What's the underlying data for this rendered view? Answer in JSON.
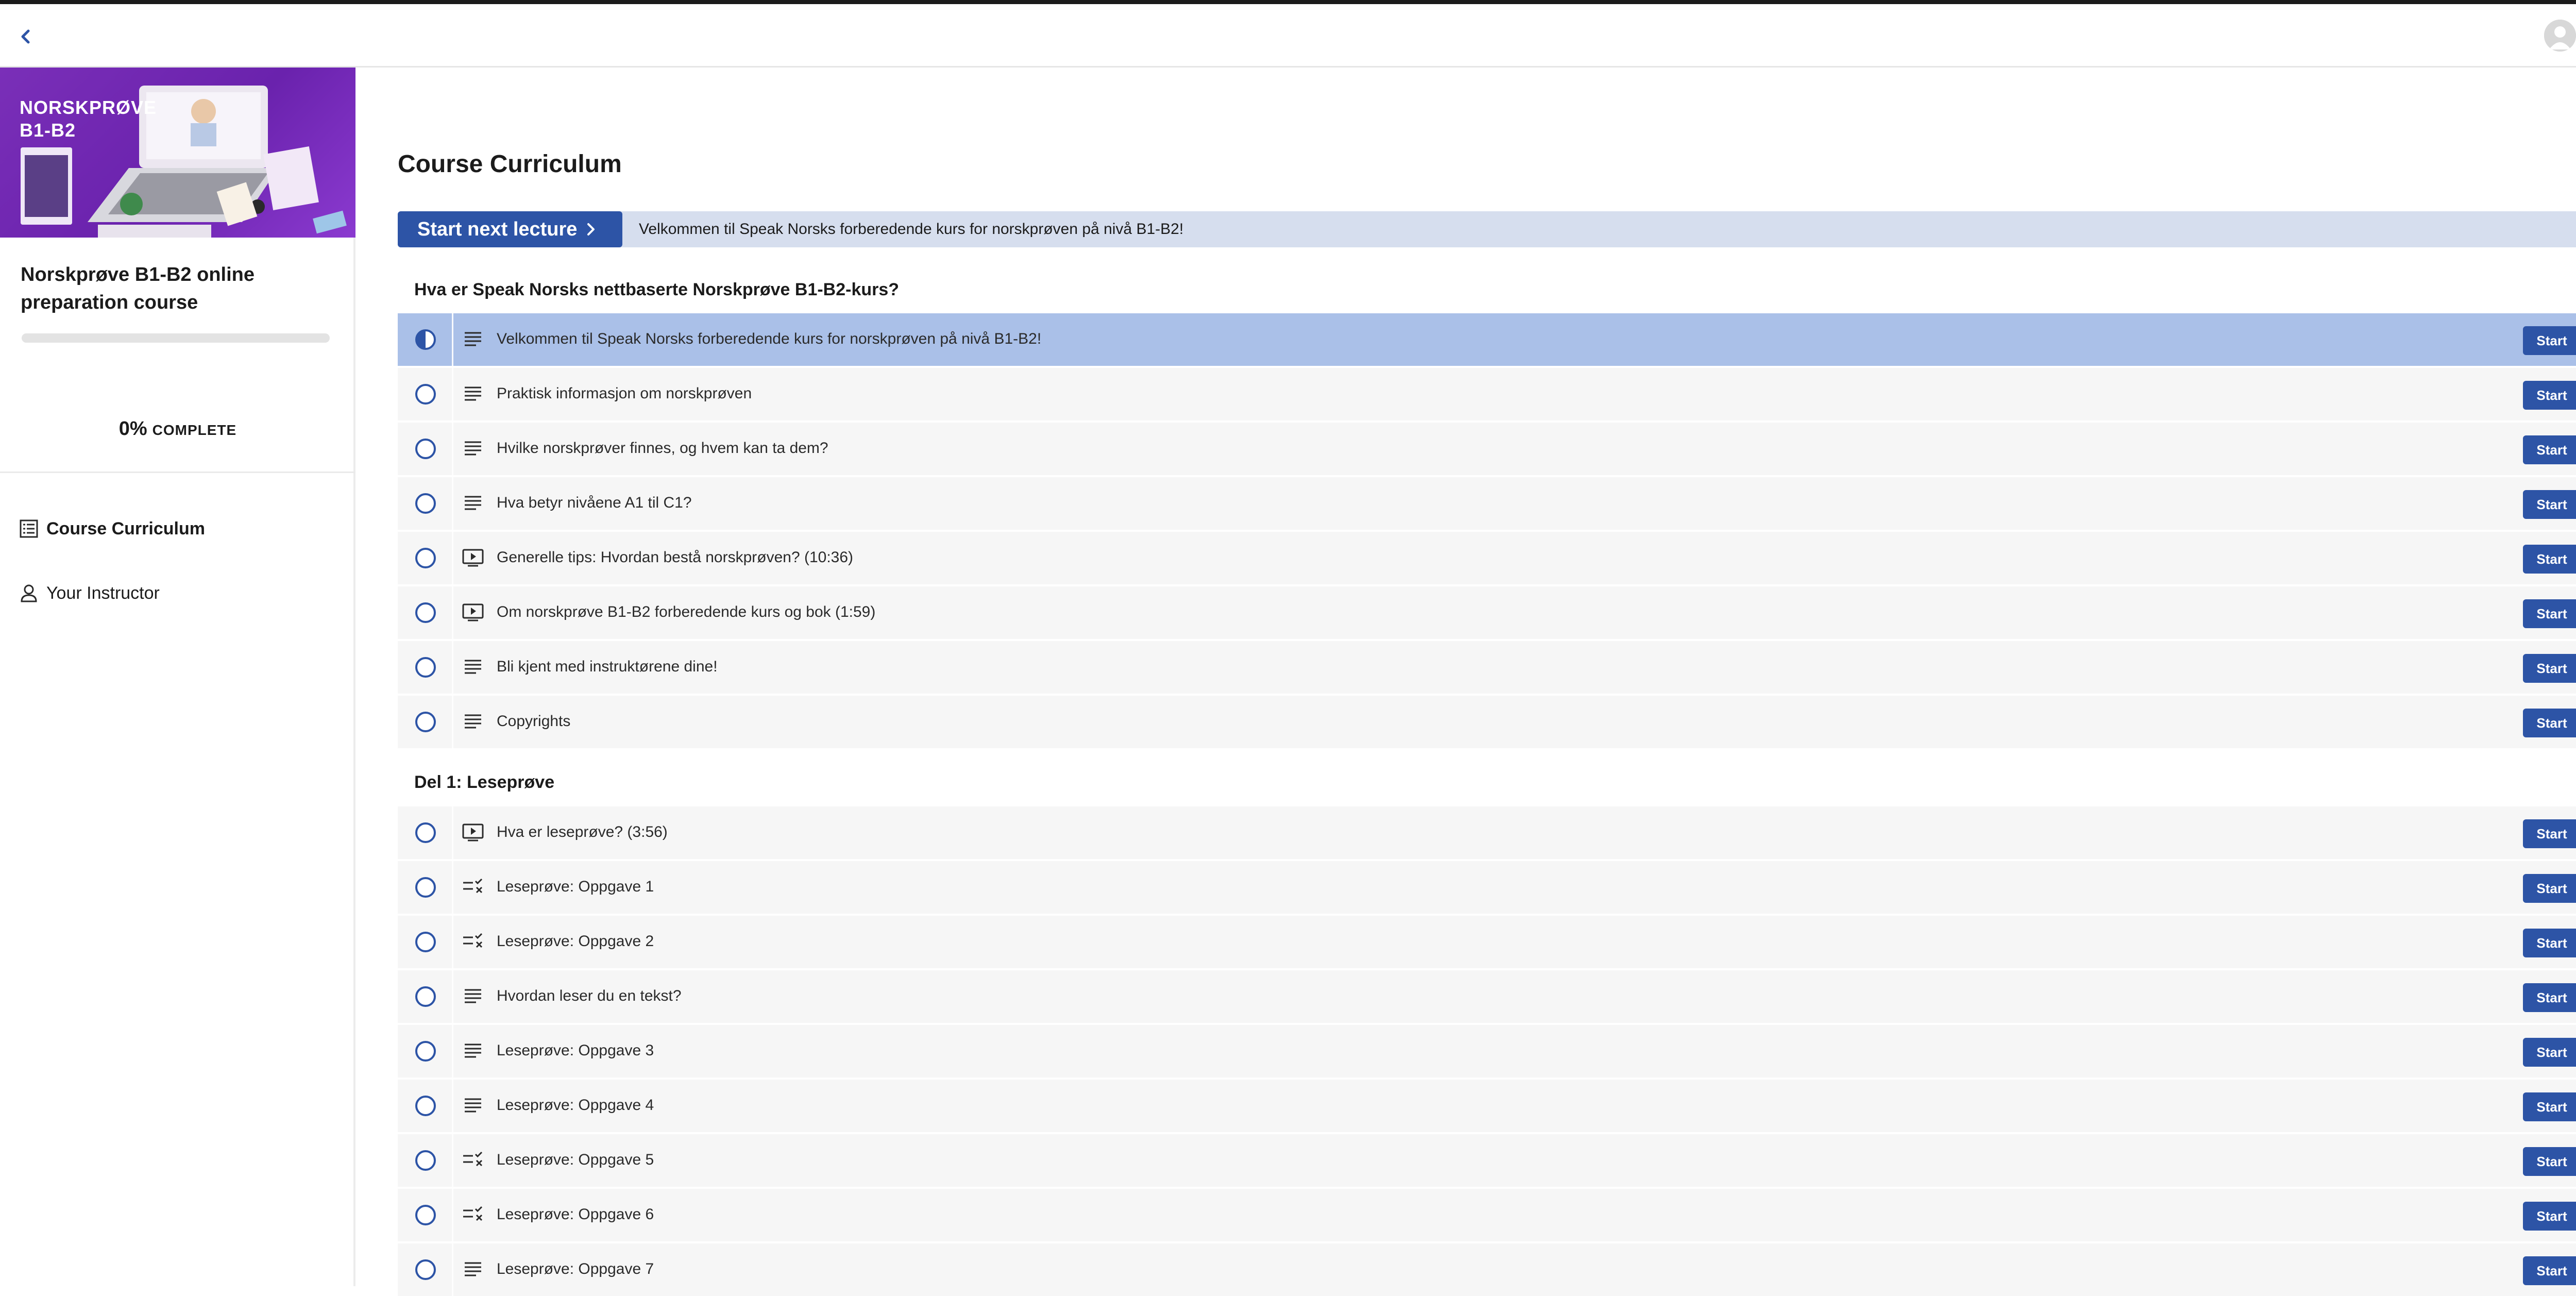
{
  "banner": {
    "title": "NORSKPRØVE\nB1-B2"
  },
  "course": {
    "title": "Norskprøve B1-B2 online preparation course",
    "progress_percent": 0,
    "progress_pct_text": "0%",
    "progress_label": "COMPLETE"
  },
  "nav": {
    "items": [
      {
        "label": "Course Curriculum",
        "icon": "curriculum-list-icon",
        "active": true
      },
      {
        "label": "Your Instructor",
        "icon": "person-icon",
        "active": false
      }
    ]
  },
  "main": {
    "title": "Course Curriculum",
    "next_button_label": "Start next lecture",
    "next_lecture_text": "Velkommen til Speak Norsks forberedende kurs for norskprøven på nivå B1-B2!"
  },
  "sections": [
    {
      "title": "Hva er Speak Norsks nettbaserte Norskprøve B1-B2-kurs?",
      "lectures": [
        {
          "title": "Velkommen til Speak Norsks forberedende kurs for norskprøven på nivå B1-B2!",
          "type": "text",
          "status": "in-progress",
          "current": true,
          "action": "Start"
        },
        {
          "title": "Praktisk informasjon om norskprøven",
          "type": "text",
          "status": "not-started",
          "action": "Start"
        },
        {
          "title": "Hvilke norskprøver finnes, og hvem kan ta dem?",
          "type": "text",
          "status": "not-started",
          "action": "Start"
        },
        {
          "title": "Hva betyr nivåene A1 til C1?",
          "type": "text",
          "status": "not-started",
          "action": "Start"
        },
        {
          "title": "Generelle tips: Hvordan bestå norskprøven? (10:36)",
          "type": "video",
          "status": "not-started",
          "action": "Start"
        },
        {
          "title": "Om norskprøve B1-B2 forberedende kurs og bok (1:59)",
          "type": "video",
          "status": "not-started",
          "action": "Start"
        },
        {
          "title": "Bli kjent med instruktørene dine!",
          "type": "text",
          "status": "not-started",
          "action": "Start"
        },
        {
          "title": "Copyrights",
          "type": "text",
          "status": "not-started",
          "action": "Start"
        }
      ]
    },
    {
      "title": "Del 1: Leseprøve",
      "lectures": [
        {
          "title": "Hva er leseprøve? (3:56)",
          "type": "video",
          "status": "not-started",
          "action": "Start"
        },
        {
          "title": "Leseprøve: Oppgave 1",
          "type": "quiz",
          "status": "not-started",
          "action": "Start"
        },
        {
          "title": "Leseprøve: Oppgave 2",
          "type": "quiz",
          "status": "not-started",
          "action": "Start"
        },
        {
          "title": "Hvordan leser du en tekst?",
          "type": "text",
          "status": "not-started",
          "action": "Start"
        },
        {
          "title": "Leseprøve: Oppgave 3",
          "type": "text",
          "status": "not-started",
          "action": "Start"
        },
        {
          "title": "Leseprøve: Oppgave 4",
          "type": "text",
          "status": "not-started",
          "action": "Start"
        },
        {
          "title": "Leseprøve: Oppgave 5",
          "type": "quiz",
          "status": "not-started",
          "action": "Start"
        },
        {
          "title": "Leseprøve: Oppgave 6",
          "type": "quiz",
          "status": "not-started",
          "action": "Start"
        },
        {
          "title": "Leseprøve: Oppgave 7",
          "type": "text",
          "status": "not-started",
          "action": "Start"
        }
      ]
    }
  ],
  "colors": {
    "accent": "#2d54a6",
    "current_row": "#aac0e8",
    "banner": "#6a22ad"
  },
  "icons": {
    "back": "chevron-left-icon",
    "avatar": "user-avatar-icon"
  }
}
